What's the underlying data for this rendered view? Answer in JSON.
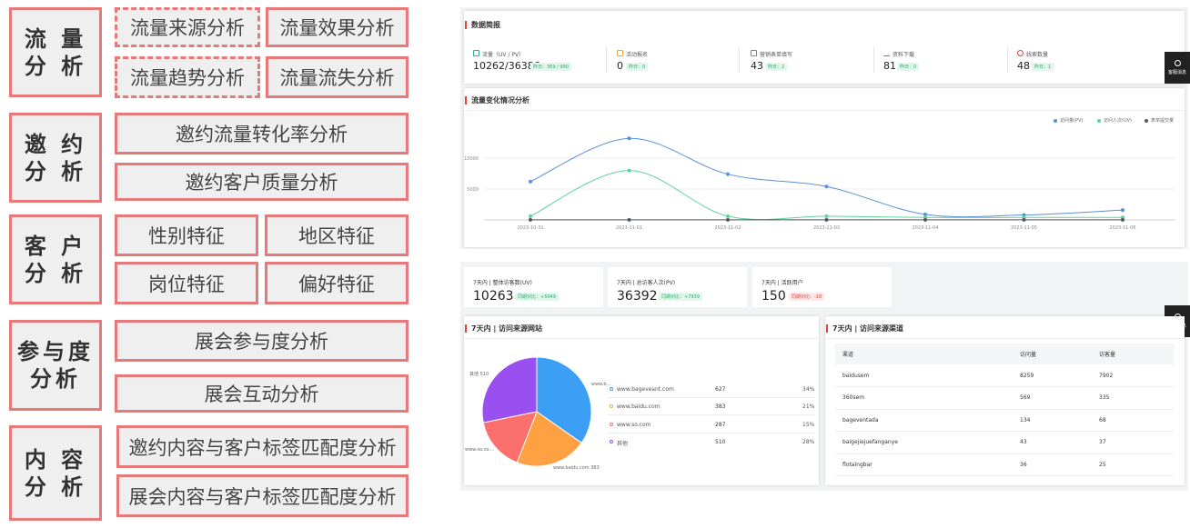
{
  "taxonomy": {
    "categories": [
      {
        "label": "流 量\n分 析",
        "items": [
          "流量来源分析",
          "流量效果分析",
          "流量趋势分析",
          "流量流失分析"
        ]
      },
      {
        "label": "邀 约\n分 析",
        "items": [
          "邀约流量转化率分析",
          "邀约客户质量分析"
        ]
      },
      {
        "label": "客 户\n分 析",
        "items": [
          "性别特征",
          "地区特征",
          "岗位特征",
          "偏好特征"
        ]
      },
      {
        "label": "参与度\n分析",
        "items": [
          "展会参与度分析",
          "展会互动分析"
        ]
      },
      {
        "label": "内 容\n分 析",
        "items": [
          "邀约内容与客户标签匹配度分析",
          "展会内容与客户标签匹配度分析"
        ]
      }
    ]
  },
  "summary": {
    "title": "数据简报",
    "stats": [
      {
        "label": "流量（UV / PV）",
        "value": "10262/36386",
        "tag": "昨日：369 / 990",
        "icon": "traffic-icon",
        "color": "#3aa59a"
      },
      {
        "label": "活动报名",
        "value": "0",
        "tag": "昨日：0",
        "icon": "signup-icon",
        "color": "#f3a43a"
      },
      {
        "label": "营销表单填写",
        "value": "43",
        "tag": "昨日：2",
        "icon": "form-icon",
        "color": "#4a90d9"
      },
      {
        "label": "资料下载",
        "value": "81",
        "tag": "昨日：0",
        "icon": "download-icon",
        "color": "#e0403a"
      },
      {
        "label": "线索数量",
        "value": "48",
        "tag": "昨日：1",
        "icon": "lead-icon",
        "color": "#e0403a"
      }
    ]
  },
  "trend": {
    "title": "流量变化情况分析",
    "legend": [
      "访问量(PV)",
      "访问人次(UV)",
      "表单提交量"
    ]
  },
  "chart_data": {
    "type": "line",
    "x": [
      "2023-10-31",
      "2023-11-01",
      "2023-11-02",
      "2023-11-03",
      "2023-11-04",
      "2023-11-05",
      "2023-11-06"
    ],
    "yticks": [
      "10000",
      "5000"
    ],
    "ylim": [
      0,
      15000
    ],
    "series": [
      {
        "name": "访问量(PV)",
        "color": "#5b8fd8",
        "values": [
          6200,
          13200,
          7400,
          5400,
          900,
          800,
          1600
        ]
      },
      {
        "name": "访问人次(UV)",
        "color": "#5fd39b",
        "values": [
          600,
          8000,
          600,
          600,
          400,
          400,
          400
        ]
      },
      {
        "name": "表单提交量",
        "color": "#505860",
        "values": [
          20,
          20,
          10,
          10,
          10,
          10,
          10
        ]
      }
    ]
  },
  "cards": [
    {
      "label": "7天内 | 整体访客数(UV)",
      "value": "10263",
      "tag": "同期对比：+5049",
      "tag_type": "up"
    },
    {
      "label": "7天内 | 总访客人次(PV)",
      "value": "36392",
      "tag": "同期对比：+7939",
      "tag_type": "up"
    },
    {
      "label": "7天内 | 活跃用户",
      "value": "150",
      "tag": "同期对比：-18",
      "tag_type": "down"
    }
  ],
  "source_site": {
    "title": "7天内 | 访问来源网站",
    "rows": [
      {
        "name": "www.bageveant.com",
        "value": "627",
        "pct": "34%",
        "color": "#3a9ff5"
      },
      {
        "name": "www.baidu.com",
        "value": "383",
        "pct": "21%",
        "color": "#fea142"
      },
      {
        "name": "www.so.com",
        "value": "287",
        "pct": "15%",
        "color": "#fb6f6d"
      },
      {
        "name": "其他",
        "value": "510",
        "pct": "28%",
        "color": "#9a50f0"
      }
    ],
    "pie_labels": {
      "other": "其他  510",
      "bag": "www.b...",
      "so": "www.so.co...",
      "baidu": "www.baidu.com  383"
    }
  },
  "source_channel": {
    "title": "7天内 | 访问来源渠道",
    "headers": [
      "渠道",
      "访问量",
      "访客量"
    ],
    "rows": [
      [
        "baidusem",
        "8259",
        "7902"
      ],
      [
        "360sem",
        "569",
        "335"
      ],
      [
        "bageventada",
        "134",
        "68"
      ],
      [
        "baigejiejuefanganye",
        "43",
        "37"
      ],
      [
        "flotaingbar",
        "36",
        "25"
      ]
    ]
  },
  "side_button": {
    "label": "客服消息"
  }
}
